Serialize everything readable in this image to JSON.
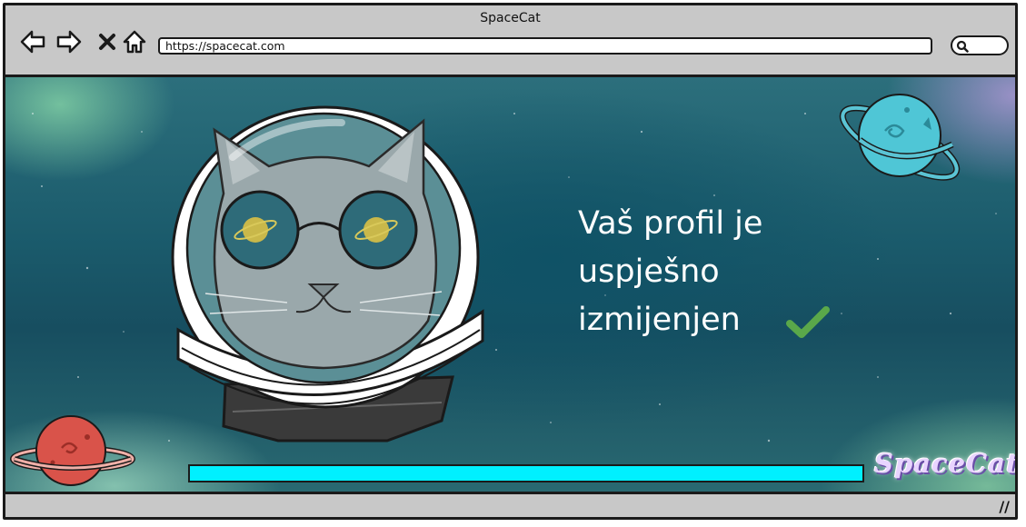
{
  "window": {
    "title": "SpaceCat"
  },
  "nav": {
    "back_icon": "arrow-left-icon",
    "forward_icon": "arrow-right-icon",
    "close_icon": "x-icon",
    "home_icon": "home-icon"
  },
  "address_bar": {
    "url": "https://spacecat.com"
  },
  "search": {
    "icon": "search-icon"
  },
  "main": {
    "message_lines": [
      "Vaš profil je",
      "uspješno",
      "izmijenjen"
    ],
    "success_icon": "checkmark-icon",
    "progress": 1.0,
    "logo_text": "SpaceCat"
  },
  "colors": {
    "progress_fill": "#00f0ff",
    "check": "#5aa84a",
    "planet_cyan": "#4fc6d6",
    "planet_red": "#d9534a"
  }
}
